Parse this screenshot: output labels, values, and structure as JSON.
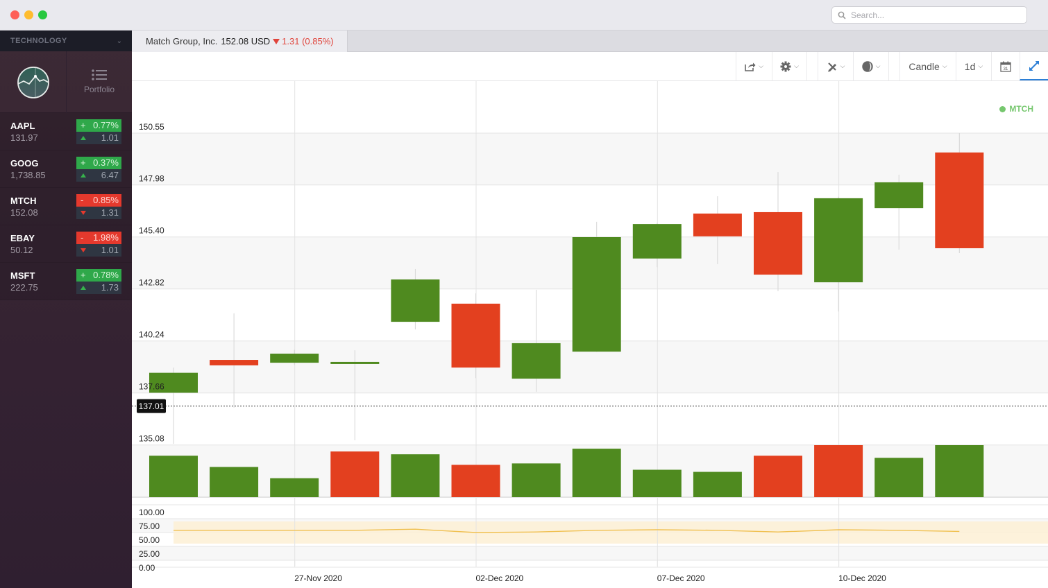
{
  "window": {
    "search_placeholder": "Search..."
  },
  "sidebar": {
    "sector_label": "TECHNOLOGY",
    "nav_portfolio_label": "Portfolio",
    "tickers": [
      {
        "symbol": "AAPL",
        "price": "131.97",
        "direction": "up",
        "pct_sign": "+",
        "pct": "0.77%",
        "change": "1.01"
      },
      {
        "symbol": "GOOG",
        "price": "1,738.85",
        "direction": "up",
        "pct_sign": "+",
        "pct": "0.37%",
        "change": "6.47"
      },
      {
        "symbol": "MTCH",
        "price": "152.08",
        "direction": "down",
        "pct_sign": "-",
        "pct": "0.85%",
        "change": "1.31"
      },
      {
        "symbol": "EBAY",
        "price": "50.12",
        "direction": "down",
        "pct_sign": "-",
        "pct": "1.98%",
        "change": "1.01"
      },
      {
        "symbol": "MSFT",
        "price": "222.75",
        "direction": "up",
        "pct_sign": "+",
        "pct": "0.78%",
        "change": "1.73"
      }
    ]
  },
  "tab": {
    "company": "Match Group, Inc.",
    "price": "152.08 USD",
    "change": "1.31 (0.85%)"
  },
  "toolbar": {
    "chart_type": "Candle",
    "interval": "1d",
    "calendar_day": "31"
  },
  "colors": {
    "up": "#4f8a1f",
    "down": "#e3401f",
    "legend": "#76c76e",
    "rsi_line": "#f0c050",
    "rsi_band": "#fdf0d5",
    "accent": "#2c7fd6"
  },
  "chart_data": {
    "type": "candlestick",
    "symbol": "MTCH",
    "legend": "MTCH",
    "legend_position": "top-right",
    "grid": true,
    "y_ticks": [
      "150.55",
      "147.98",
      "145.40",
      "142.82",
      "140.24",
      "137.66",
      "135.08"
    ],
    "y_tick_values": [
      150.55,
      147.98,
      145.4,
      142.82,
      140.24,
      137.66,
      135.08
    ],
    "ylim": [
      134.2,
      152.5
    ],
    "current_price_label": "137.01",
    "current_price": 137.01,
    "x_labels": [
      {
        "label": "27-Nov 2020",
        "index": 2
      },
      {
        "label": "02-Dec 2020",
        "index": 5
      },
      {
        "label": "07-Dec 2020",
        "index": 8
      },
      {
        "label": "10-Dec 2020",
        "index": 11
      }
    ],
    "candles": [
      {
        "o": 137.67,
        "h": 138.92,
        "l": 135.14,
        "c": 138.66
      },
      {
        "o": 139.3,
        "h": 141.61,
        "l": 136.93,
        "c": 139.03
      },
      {
        "o": 139.16,
        "h": 139.8,
        "l": 139.05,
        "c": 139.61
      },
      {
        "o": 139.1,
        "h": 139.78,
        "l": 135.31,
        "c": 139.2
      },
      {
        "o": 141.19,
        "h": 143.81,
        "l": 140.81,
        "c": 143.29
      },
      {
        "o": 142.09,
        "h": 142.6,
        "l": 138.4,
        "c": 138.92
      },
      {
        "o": 138.37,
        "h": 142.78,
        "l": 137.72,
        "c": 140.13
      },
      {
        "o": 139.71,
        "h": 146.15,
        "l": 139.7,
        "c": 145.39
      },
      {
        "o": 144.33,
        "h": 146.1,
        "l": 143.9,
        "c": 146.04
      },
      {
        "o": 146.56,
        "h": 147.42,
        "l": 144.05,
        "c": 145.43
      },
      {
        "o": 146.63,
        "h": 148.62,
        "l": 142.71,
        "c": 143.53
      },
      {
        "o": 143.15,
        "h": 147.4,
        "l": 141.7,
        "c": 147.32
      },
      {
        "o": 146.83,
        "h": 148.49,
        "l": 144.77,
        "c": 148.11
      },
      {
        "o": 149.59,
        "h": 150.55,
        "l": 144.6,
        "c": 144.84
      }
    ],
    "volume": {
      "values": [
        59,
        43,
        27,
        65,
        61,
        46,
        48,
        69,
        39,
        36,
        59,
        74,
        56,
        74
      ],
      "colors": [
        "up",
        "up",
        "up",
        "down",
        "up",
        "down",
        "up",
        "up",
        "up",
        "up",
        "down",
        "down",
        "up",
        "up"
      ],
      "unit": "relative"
    },
    "rsi": {
      "y_ticks": [
        "100.00",
        "75.00",
        "50.00",
        "25.00",
        "0.00"
      ],
      "y_tick_values": [
        100,
        75,
        50,
        25,
        0
      ],
      "band": [
        30,
        70
      ],
      "values": [
        54,
        54,
        54,
        54,
        56,
        50,
        51,
        54,
        55,
        54,
        51,
        55,
        54,
        52
      ]
    }
  }
}
